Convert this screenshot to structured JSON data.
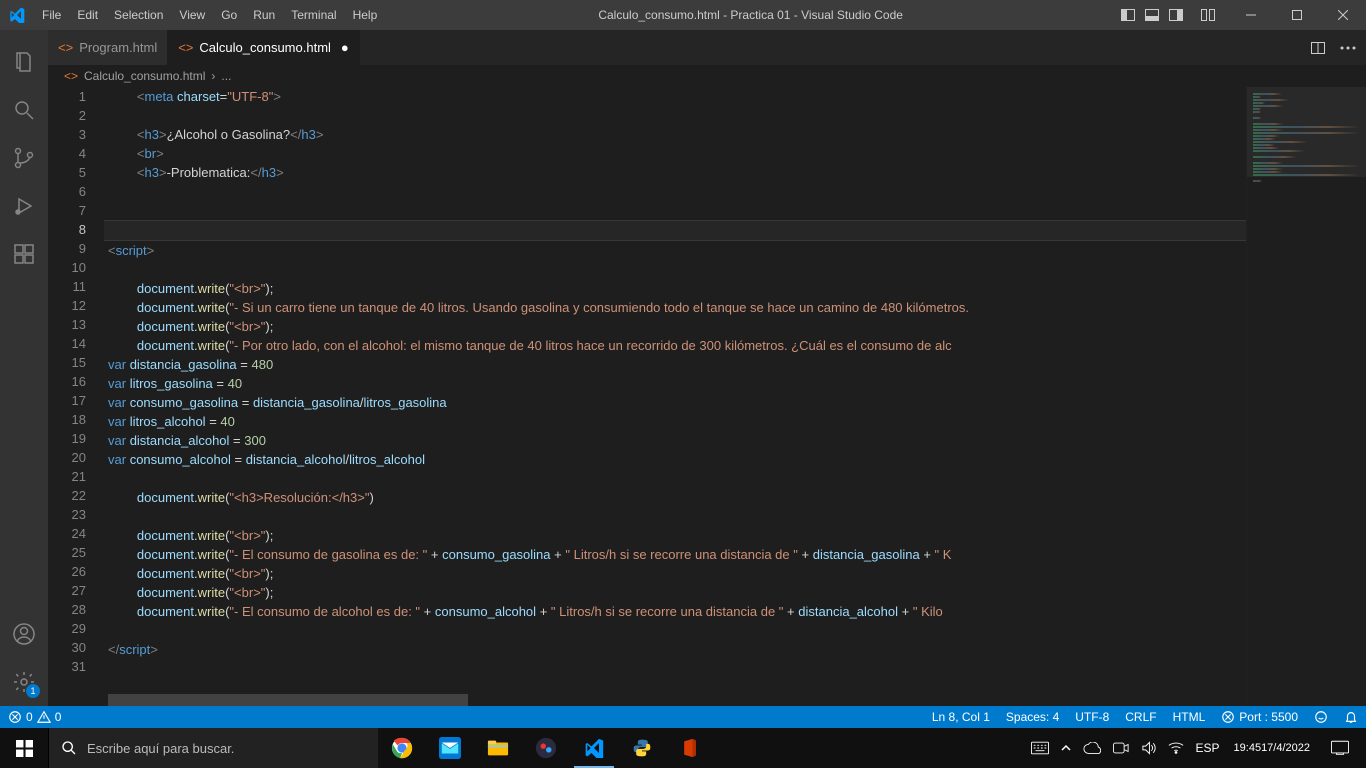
{
  "titlebar": {
    "menus": [
      "File",
      "Edit",
      "Selection",
      "View",
      "Go",
      "Run",
      "Terminal",
      "Help"
    ],
    "title": "Calculo_consumo.html - Practica 01 - Visual Studio Code"
  },
  "tabs": [
    {
      "label": "Program.html",
      "active": false
    },
    {
      "label": "Calculo_consumo.html",
      "active": true,
      "dirty": true
    }
  ],
  "breadcrumb": {
    "file": "Calculo_consumo.html",
    "rest": "..."
  },
  "activitybar": {
    "settings_badge": "1"
  },
  "editor": {
    "current_line": 8,
    "lines": [
      {
        "n": 1,
        "indent": 2,
        "tokens": [
          [
            "tg",
            "<"
          ],
          [
            "tag",
            "meta"
          ],
          [
            "txt",
            " "
          ],
          [
            "attr",
            "charset"
          ],
          [
            "op",
            "="
          ],
          [
            "str",
            "\"UTF-8\""
          ],
          [
            "tg",
            ">"
          ]
        ]
      },
      {
        "n": 2,
        "indent": 2,
        "tokens": []
      },
      {
        "n": 3,
        "indent": 2,
        "tokens": [
          [
            "tg",
            "<"
          ],
          [
            "tag",
            "h3"
          ],
          [
            "tg",
            ">"
          ],
          [
            "txt",
            "¿Alcohol o Gasolina?"
          ],
          [
            "tg",
            "</"
          ],
          [
            "tag",
            "h3"
          ],
          [
            "tg",
            ">"
          ]
        ]
      },
      {
        "n": 4,
        "indent": 2,
        "tokens": [
          [
            "tg",
            "<"
          ],
          [
            "tag",
            "br"
          ],
          [
            "tg",
            ">"
          ]
        ]
      },
      {
        "n": 5,
        "indent": 2,
        "tokens": [
          [
            "tg",
            "<"
          ],
          [
            "tag",
            "h3"
          ],
          [
            "tg",
            ">"
          ],
          [
            "txt",
            "-Problematica:"
          ],
          [
            "tg",
            "</"
          ],
          [
            "tag",
            "h3"
          ],
          [
            "tg",
            ">"
          ]
        ]
      },
      {
        "n": 6,
        "indent": 2,
        "tokens": []
      },
      {
        "n": 7,
        "indent": 2,
        "tokens": []
      },
      {
        "n": 8,
        "indent": 0,
        "tokens": []
      },
      {
        "n": 9,
        "indent": 0,
        "tokens": [
          [
            "tg",
            "<"
          ],
          [
            "tag",
            "script"
          ],
          [
            "tg",
            ">"
          ]
        ]
      },
      {
        "n": 10,
        "indent": 0,
        "tokens": []
      },
      {
        "n": 11,
        "indent": 2,
        "tokens": [
          [
            "var",
            "document"
          ],
          [
            "txt",
            "."
          ],
          [
            "fn",
            "write"
          ],
          [
            "txt",
            "("
          ],
          [
            "str",
            "\"<br>\""
          ],
          [
            "txt",
            ");"
          ]
        ]
      },
      {
        "n": 12,
        "indent": 2,
        "tokens": [
          [
            "var",
            "document"
          ],
          [
            "txt",
            "."
          ],
          [
            "fn",
            "write"
          ],
          [
            "txt",
            "("
          ],
          [
            "str",
            "\"- Si un carro tiene un tanque de 40 litros. Usando gasolina y consumiendo todo el tanque se hace un camino de 480 kilómetros."
          ],
          [
            "txt",
            ""
          ]
        ]
      },
      {
        "n": 13,
        "indent": 2,
        "tokens": [
          [
            "var",
            "document"
          ],
          [
            "txt",
            "."
          ],
          [
            "fn",
            "write"
          ],
          [
            "txt",
            "("
          ],
          [
            "str",
            "\"<br>\""
          ],
          [
            "txt",
            ");"
          ]
        ]
      },
      {
        "n": 14,
        "indent": 2,
        "tokens": [
          [
            "var",
            "document"
          ],
          [
            "txt",
            "."
          ],
          [
            "fn",
            "write"
          ],
          [
            "txt",
            "("
          ],
          [
            "str",
            "\"- Por otro lado, con el alcohol: el mismo tanque de 40 litros hace un recorrido de 300 kilómetros. ¿Cuál es el consumo de alc"
          ],
          [
            "txt",
            ""
          ]
        ]
      },
      {
        "n": 15,
        "indent": 0,
        "tokens": [
          [
            "kw",
            "var"
          ],
          [
            "txt",
            " "
          ],
          [
            "var",
            "distancia_gasolina"
          ],
          [
            "txt",
            " "
          ],
          [
            "op",
            "="
          ],
          [
            "txt",
            " "
          ],
          [
            "num",
            "480"
          ]
        ]
      },
      {
        "n": 16,
        "indent": 0,
        "tokens": [
          [
            "kw",
            "var"
          ],
          [
            "txt",
            " "
          ],
          [
            "var",
            "litros_gasolina"
          ],
          [
            "txt",
            " "
          ],
          [
            "op",
            "="
          ],
          [
            "txt",
            " "
          ],
          [
            "num",
            "40"
          ]
        ]
      },
      {
        "n": 17,
        "indent": 0,
        "tokens": [
          [
            "kw",
            "var"
          ],
          [
            "txt",
            " "
          ],
          [
            "var",
            "consumo_gasolina"
          ],
          [
            "txt",
            " "
          ],
          [
            "op",
            "="
          ],
          [
            "txt",
            " "
          ],
          [
            "var",
            "distancia_gasolina"
          ],
          [
            "op",
            "/"
          ],
          [
            "var",
            "litros_gasolina"
          ]
        ]
      },
      {
        "n": 18,
        "indent": 0,
        "tokens": [
          [
            "kw",
            "var"
          ],
          [
            "txt",
            " "
          ],
          [
            "var",
            "litros_alcohol"
          ],
          [
            "txt",
            " "
          ],
          [
            "op",
            "="
          ],
          [
            "txt",
            " "
          ],
          [
            "num",
            "40"
          ]
        ]
      },
      {
        "n": 19,
        "indent": 0,
        "tokens": [
          [
            "kw",
            "var"
          ],
          [
            "txt",
            " "
          ],
          [
            "var",
            "distancia_alcohol"
          ],
          [
            "txt",
            " "
          ],
          [
            "op",
            "="
          ],
          [
            "txt",
            " "
          ],
          [
            "num",
            "300"
          ]
        ]
      },
      {
        "n": 20,
        "indent": 0,
        "tokens": [
          [
            "kw",
            "var"
          ],
          [
            "txt",
            " "
          ],
          [
            "var",
            "consumo_alcohol"
          ],
          [
            "txt",
            " "
          ],
          [
            "op",
            "="
          ],
          [
            "txt",
            " "
          ],
          [
            "var",
            "distancia_alcohol"
          ],
          [
            "op",
            "/"
          ],
          [
            "var",
            "litros_alcohol"
          ]
        ]
      },
      {
        "n": 21,
        "indent": 0,
        "tokens": []
      },
      {
        "n": 22,
        "indent": 2,
        "tokens": [
          [
            "var",
            "document"
          ],
          [
            "txt",
            "."
          ],
          [
            "fn",
            "write"
          ],
          [
            "txt",
            "("
          ],
          [
            "str",
            "\"<h3>Resolución:</h3>\""
          ],
          [
            "txt",
            ")"
          ]
        ]
      },
      {
        "n": 23,
        "indent": 0,
        "tokens": []
      },
      {
        "n": 24,
        "indent": 2,
        "tokens": [
          [
            "var",
            "document"
          ],
          [
            "txt",
            "."
          ],
          [
            "fn",
            "write"
          ],
          [
            "txt",
            "("
          ],
          [
            "str",
            "\"<br>\""
          ],
          [
            "txt",
            ");"
          ]
        ]
      },
      {
        "n": 25,
        "indent": 2,
        "tokens": [
          [
            "var",
            "document"
          ],
          [
            "txt",
            "."
          ],
          [
            "fn",
            "write"
          ],
          [
            "txt",
            "("
          ],
          [
            "str",
            "\"- El consumo de gasolina es de: \""
          ],
          [
            "txt",
            " "
          ],
          [
            "op",
            "+"
          ],
          [
            "txt",
            " "
          ],
          [
            "var",
            "consumo_gasolina"
          ],
          [
            "txt",
            " "
          ],
          [
            "op",
            "+"
          ],
          [
            "txt",
            " "
          ],
          [
            "str",
            "\" Litros/h si se recorre una distancia de \""
          ],
          [
            "txt",
            " "
          ],
          [
            "op",
            "+"
          ],
          [
            "txt",
            " "
          ],
          [
            "var",
            "distancia_gasolina"
          ],
          [
            "txt",
            " "
          ],
          [
            "op",
            "+"
          ],
          [
            "txt",
            " "
          ],
          [
            "str",
            "\" K"
          ]
        ]
      },
      {
        "n": 26,
        "indent": 2,
        "tokens": [
          [
            "var",
            "document"
          ],
          [
            "txt",
            "."
          ],
          [
            "fn",
            "write"
          ],
          [
            "txt",
            "("
          ],
          [
            "str",
            "\"<br>\""
          ],
          [
            "txt",
            ");"
          ]
        ]
      },
      {
        "n": 27,
        "indent": 2,
        "tokens": [
          [
            "var",
            "document"
          ],
          [
            "txt",
            "."
          ],
          [
            "fn",
            "write"
          ],
          [
            "txt",
            "("
          ],
          [
            "str",
            "\"<br>\""
          ],
          [
            "txt",
            ");"
          ]
        ]
      },
      {
        "n": 28,
        "indent": 2,
        "tokens": [
          [
            "var",
            "document"
          ],
          [
            "txt",
            "."
          ],
          [
            "fn",
            "write"
          ],
          [
            "txt",
            "("
          ],
          [
            "str",
            "\"- El consumo de alcohol es de: \""
          ],
          [
            "txt",
            " "
          ],
          [
            "op",
            "+"
          ],
          [
            "txt",
            " "
          ],
          [
            "var",
            "consumo_alcohol"
          ],
          [
            "txt",
            " "
          ],
          [
            "op",
            "+"
          ],
          [
            "txt",
            " "
          ],
          [
            "str",
            "\" Litros/h si se recorre una distancia de \""
          ],
          [
            "txt",
            " "
          ],
          [
            "op",
            "+"
          ],
          [
            "txt",
            " "
          ],
          [
            "var",
            "distancia_alcohol"
          ],
          [
            "txt",
            " "
          ],
          [
            "op",
            "+"
          ],
          [
            "txt",
            " "
          ],
          [
            "str",
            "\" Kilo"
          ]
        ]
      },
      {
        "n": 29,
        "indent": 0,
        "tokens": []
      },
      {
        "n": 30,
        "indent": 0,
        "tokens": [
          [
            "tg",
            "</"
          ],
          [
            "tag",
            "script"
          ],
          [
            "tg",
            ">"
          ]
        ]
      },
      {
        "n": 31,
        "indent": 0,
        "tokens": []
      }
    ]
  },
  "statusbar": {
    "errors": "0",
    "warnings": "0",
    "cursor": "Ln 8, Col 1",
    "spaces": "Spaces: 4",
    "encoding": "UTF-8",
    "eol": "CRLF",
    "lang": "HTML",
    "port": "Port : 5500"
  },
  "taskbar": {
    "search_placeholder": "Escribe aquí para buscar.",
    "lang": "ESP",
    "time": "19:45",
    "date": "17/4/2022"
  }
}
